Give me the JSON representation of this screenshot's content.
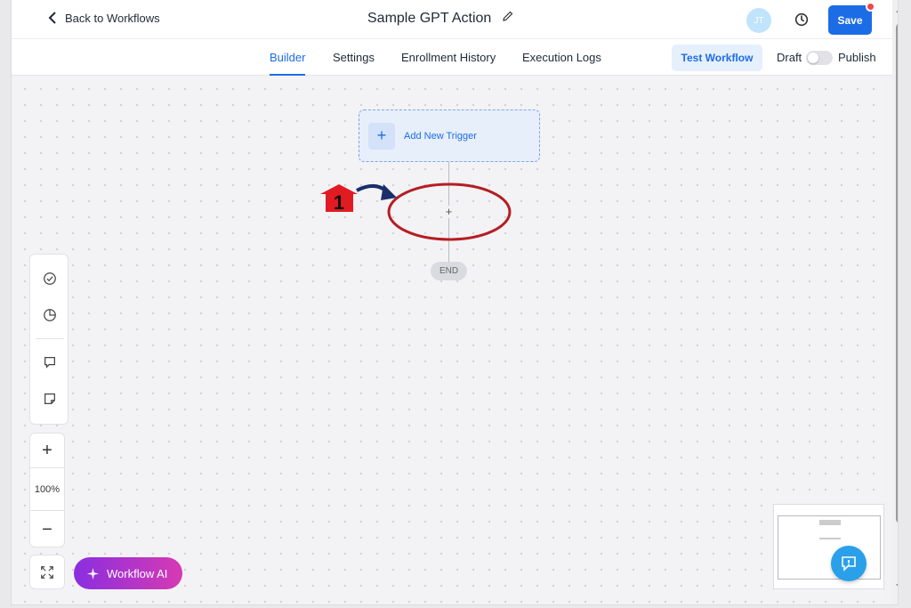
{
  "header": {
    "back_label": "Back to Workflows",
    "title": "Sample GPT Action",
    "avatar_initials": "JT",
    "save_label": "Save"
  },
  "tabs": [
    {
      "label": "Builder",
      "active": true
    },
    {
      "label": "Settings",
      "active": false
    },
    {
      "label": "Enrollment History",
      "active": false
    },
    {
      "label": "Execution Logs",
      "active": false
    }
  ],
  "toolbar": {
    "test_label": "Test Workflow",
    "draft_label": "Draft",
    "publish_label": "Publish"
  },
  "canvas": {
    "trigger_label": "Add New Trigger",
    "add_step_symbol": "+",
    "end_label": "END"
  },
  "zoom": {
    "plus": "+",
    "level": "100%",
    "minus": "−"
  },
  "workflow_ai_label": "Workflow AI",
  "annotation": {
    "step_number": "1"
  },
  "colors": {
    "accent": "#1c6ce6",
    "annotation_red": "#b51e23",
    "annotation_arrow": "#1b2d6b"
  }
}
